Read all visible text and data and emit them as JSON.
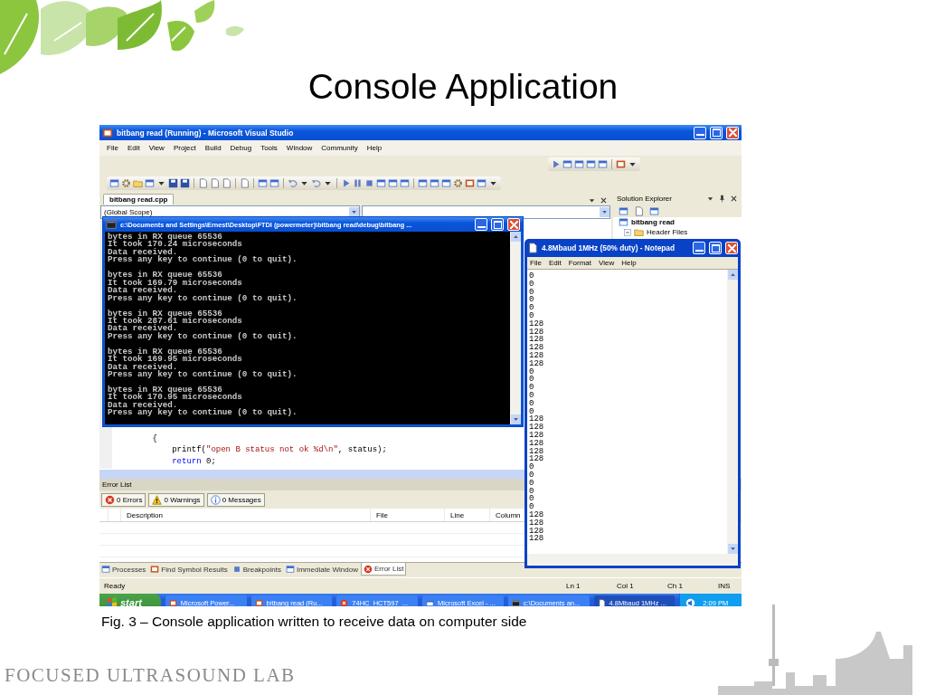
{
  "slide": {
    "title": "Console Application",
    "caption": "Fig. 3 – Console application written to receive data on computer side",
    "footer": "FOCUSED ULTRASOUND LAB"
  },
  "ide": {
    "title": "bitbang read (Running) - Microsoft Visual Studio",
    "menu": [
      "File",
      "Edit",
      "View",
      "Project",
      "Build",
      "Debug",
      "Tools",
      "Window",
      "Community",
      "Help"
    ],
    "document_tab": "bitbang read.cpp",
    "scope": "(Global Scope)",
    "code_lines": [
      [
        {
          "text": "    {",
          "kind": "plain"
        }
      ],
      [
        {
          "text": "        printf(",
          "kind": "plain"
        },
        {
          "text": "\"open B status not ok %d\\n\"",
          "kind": "string"
        },
        {
          "text": ", status);",
          "kind": "plain"
        }
      ],
      [
        {
          "text": "        return",
          "kind": "keyword"
        },
        {
          "text": " 0;",
          "kind": "plain"
        }
      ]
    ],
    "solution_explorer": {
      "title": "Solution Explorer",
      "tree": [
        {
          "label": "bitbang read",
          "children": [
            {
              "label": "Header Files",
              "expanded": true
            }
          ]
        }
      ]
    },
    "error_list": {
      "title": "Error List",
      "filters": [
        {
          "kind": "error",
          "label": "0 Errors"
        },
        {
          "kind": "warning",
          "label": "0 Warnings"
        },
        {
          "kind": "info",
          "label": "0 Messages"
        }
      ],
      "columns": [
        "Description",
        "File",
        "Line",
        "Column"
      ]
    },
    "bottom_tabs": [
      {
        "label": "Processes",
        "selected": false
      },
      {
        "label": "Find Symbol Results",
        "selected": false
      },
      {
        "label": "Breakpoints",
        "selected": false
      },
      {
        "label": "Immediate Window",
        "selected": false
      },
      {
        "label": "Error List",
        "selected": true
      }
    ],
    "status_bar": {
      "message": "Ready",
      "cells": [
        "Ln 1",
        "Col 1",
        "Ch 1",
        "INS"
      ]
    }
  },
  "console": {
    "title": "c:\\Documents and Settings\\Ernest\\Desktop\\FTDI (powermeter)\\bitbang read\\debug\\bitbang ...",
    "blocks": [
      [
        "bytes in RX queue 65536",
        "It took 170.24 microseconds",
        "Data received.",
        "Press any key to continue (0 to quit)."
      ],
      [
        "bytes in RX queue 65536",
        "It took 169.79 microseconds",
        "Data received.",
        "Press any key to continue (0 to quit)."
      ],
      [
        "bytes in RX queue 65536",
        "It took 287.61 microseconds",
        "Data received.",
        "Press any key to continue (0 to quit)."
      ],
      [
        "bytes in RX queue 65536",
        "It took 169.95 microseconds",
        "Data received.",
        "Press any key to continue (0 to quit)."
      ],
      [
        "bytes in RX queue 65536",
        "It took 170.95 microseconds",
        "Data received.",
        "Press any key to continue (0 to quit)."
      ]
    ]
  },
  "notepad": {
    "title": "4.8Mbaud 1MHz (50% duty) - Notepad",
    "menu": [
      "File",
      "Edit",
      "Format",
      "View",
      "Help"
    ],
    "lines": [
      "0",
      "0",
      "0",
      "0",
      "0",
      "0",
      "128",
      "128",
      "128",
      "128",
      "128",
      "128",
      "0",
      "0",
      "0",
      "0",
      "0",
      "0",
      "128",
      "128",
      "128",
      "128",
      "128",
      "128",
      "0",
      "0",
      "0",
      "0",
      "0",
      "0",
      "128",
      "128",
      "128",
      "128"
    ]
  },
  "taskbar": {
    "start": "start",
    "items": [
      {
        "label": "Microsoft Power...",
        "selected": false
      },
      {
        "label": "bitbang read (Ru...",
        "selected": false
      },
      {
        "label": "74HC_HCT597_...",
        "selected": false
      },
      {
        "label": "Microsoft Excel - ...",
        "selected": false
      },
      {
        "label": "c:\\Documents an...",
        "selected": false
      },
      {
        "label": "4.8Mbaud 1MHz ...",
        "selected": true
      }
    ],
    "clock": "2:09 PM"
  }
}
